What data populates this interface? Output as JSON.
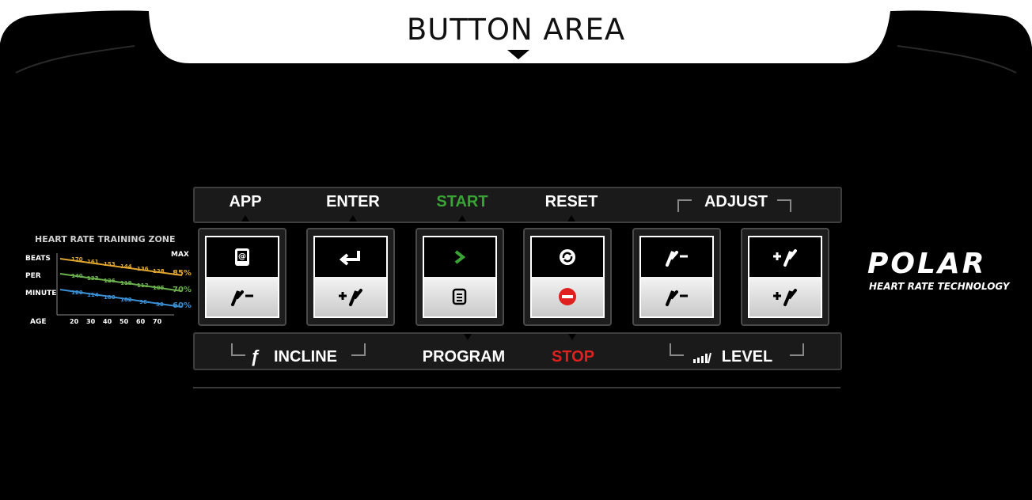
{
  "title": "BUTTON AREA",
  "colors": {
    "console": "#000000",
    "start": "#3aa335",
    "stop": "#e0201f",
    "zone85": "#e0a630",
    "zone70": "#6ab04c",
    "zone60": "#3b8fd4"
  },
  "top_labels": {
    "app": "APP",
    "enter": "ENTER",
    "start": "START",
    "reset": "RESET",
    "adjust": "ADJUST"
  },
  "bottom_labels": {
    "incline": "INCLINE",
    "program": "PROGRAM",
    "stop": "STOP",
    "level": "LEVEL"
  },
  "buttons": [
    {
      "top_icon": "app-icon",
      "bottom_icon": "incline-down-icon"
    },
    {
      "top_icon": "enter-icon",
      "bottom_icon": "incline-up-icon"
    },
    {
      "top_icon": "start-icon",
      "bottom_icon": "program-icon"
    },
    {
      "top_icon": "reset-icon",
      "bottom_icon": "stop-icon"
    },
    {
      "top_icon": "adjust-down-icon",
      "bottom_icon": "level-down-icon"
    },
    {
      "top_icon": "adjust-up-icon",
      "bottom_icon": "level-up-icon"
    }
  ],
  "heart_rate": {
    "heading": "HEART RATE TRAINING ZONE",
    "row_labels": [
      "BEATS",
      "PER",
      "MINUTE"
    ],
    "max_label": "MAX",
    "age_label": "AGE",
    "ages": [
      "20",
      "30",
      "40",
      "50",
      "60",
      "70"
    ],
    "zones": [
      {
        "percent": "85%",
        "values": [
          "170",
          "161",
          "153",
          "144",
          "136",
          "128"
        ]
      },
      {
        "percent": "70%",
        "values": [
          "140",
          "133",
          "126",
          "119",
          "112",
          "105"
        ]
      },
      {
        "percent": "60%",
        "values": [
          "120",
          "114",
          "108",
          "102",
          "96",
          "90"
        ]
      }
    ]
  },
  "brand": {
    "name": "POLAR",
    "tagline": "HEART RATE TECHNOLOGY"
  }
}
